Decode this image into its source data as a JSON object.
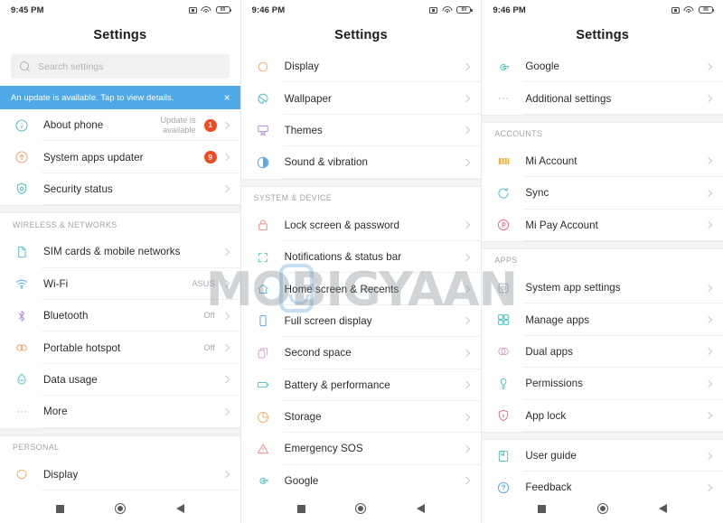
{
  "watermark": {
    "text": "MOBIGYAAN"
  },
  "navbar": {
    "recents_label": "recents",
    "home_label": "home",
    "back_label": "back"
  },
  "panels": [
    {
      "status": {
        "time": "9:45 PM",
        "battery_level": "89"
      },
      "title": "Settings",
      "search": {
        "placeholder": "Search settings"
      },
      "banner": {
        "text": "An update is available. Tap to view details.",
        "close": "×",
        "color": "#4fa8e8"
      },
      "rows": [
        {
          "type": "item",
          "icon": "info-circle-icon",
          "color": "#4dbfc4",
          "label": "About phone",
          "value": "Update is\navailable",
          "badge": "1"
        },
        {
          "type": "item",
          "icon": "system-update-icon",
          "color": "#f0a070",
          "label": "System apps updater",
          "value": "",
          "badge": "9"
        },
        {
          "type": "item",
          "icon": "shield-icon",
          "color": "#4dbfc4",
          "label": "Security status",
          "value": "",
          "badge": ""
        },
        {
          "type": "group",
          "label": "WIRELESS & NETWORKS"
        },
        {
          "type": "item",
          "icon": "sim-card-icon",
          "color": "#55c3c8",
          "label": "SIM cards & mobile networks",
          "value": "",
          "badge": ""
        },
        {
          "type": "item",
          "icon": "wifi-icon",
          "color": "#5aa8e8",
          "label": "Wi-Fi",
          "value": "ASUS",
          "badge": ""
        },
        {
          "type": "item",
          "icon": "bluetooth-icon",
          "color": "#b48ce0",
          "label": "Bluetooth",
          "value": "Off",
          "badge": ""
        },
        {
          "type": "item",
          "icon": "hotspot-icon",
          "color": "#f0a070",
          "label": "Portable hotspot",
          "value": "Off",
          "badge": ""
        },
        {
          "type": "item",
          "icon": "data-usage-icon",
          "color": "#55c3c8",
          "label": "Data usage",
          "value": "",
          "badge": ""
        },
        {
          "type": "item",
          "icon": "more-dots-icon",
          "color": "#9fb4d6",
          "label": "More",
          "value": "",
          "badge": ""
        },
        {
          "type": "group",
          "label": "PERSONAL"
        },
        {
          "type": "item",
          "icon": "display-icon",
          "color": "#efb36d",
          "label": "Display",
          "value": "",
          "badge": ""
        }
      ]
    },
    {
      "status": {
        "time": "9:46 PM",
        "battery_level": "89"
      },
      "title": "Settings",
      "rows": [
        {
          "type": "item",
          "icon": "display-icon",
          "color": "#efb36d",
          "label": "Display",
          "value": "",
          "badge": ""
        },
        {
          "type": "item",
          "icon": "wallpaper-icon",
          "color": "#55c3c8",
          "label": "Wallpaper",
          "value": "",
          "badge": ""
        },
        {
          "type": "item",
          "icon": "themes-icon",
          "color": "#b48ce0",
          "label": "Themes",
          "value": "",
          "badge": ""
        },
        {
          "type": "item",
          "icon": "sound-vibration-icon",
          "color": "#5aa8e8",
          "label": "Sound & vibration",
          "value": "",
          "badge": ""
        },
        {
          "type": "group",
          "label": "SYSTEM & DEVICE"
        },
        {
          "type": "item",
          "icon": "lock-icon",
          "color": "#ef8b8b",
          "label": "Lock screen & password",
          "value": "",
          "badge": ""
        },
        {
          "type": "item",
          "icon": "notifications-status-bar-icon",
          "color": "#55c3c8",
          "label": "Notifications & status bar",
          "value": "",
          "badge": ""
        },
        {
          "type": "item",
          "icon": "home-screen-icon",
          "color": "#55b9e0",
          "label": "Home screen & Recents",
          "value": "",
          "badge": ""
        },
        {
          "type": "item",
          "icon": "full-screen-display-icon",
          "color": "#5aa8e8",
          "label": "Full screen display",
          "value": "",
          "badge": ""
        },
        {
          "type": "item",
          "icon": "second-space-icon",
          "color": "#d79fd0",
          "label": "Second space",
          "value": "",
          "badge": ""
        },
        {
          "type": "item",
          "icon": "battery-performance-icon",
          "color": "#55c3c8",
          "label": "Battery & performance",
          "value": "",
          "badge": ""
        },
        {
          "type": "item",
          "icon": "storage-icon",
          "color": "#efb36d",
          "label": "Storage",
          "value": "",
          "badge": ""
        },
        {
          "type": "item",
          "icon": "emergency-sos-icon",
          "color": "#ef8b8b",
          "label": "Emergency SOS",
          "value": "",
          "badge": ""
        },
        {
          "type": "item",
          "icon": "google-icon",
          "color": "#4dbfc4",
          "label": "Google",
          "value": "",
          "badge": ""
        }
      ]
    },
    {
      "status": {
        "time": "9:46 PM",
        "battery_level": "89"
      },
      "title": "Settings",
      "rows": [
        {
          "type": "item",
          "icon": "google-icon",
          "color": "#4dbfc4",
          "label": "Google",
          "value": "",
          "badge": ""
        },
        {
          "type": "item",
          "icon": "additional-settings-icon",
          "color": "#9fb4d6",
          "label": "Additional settings",
          "value": "",
          "badge": ""
        },
        {
          "type": "group",
          "label": "ACCOUNTS"
        },
        {
          "type": "item",
          "icon": "mi-account-icon",
          "color": "#efb03d",
          "label": "Mi Account",
          "value": "",
          "badge": ""
        },
        {
          "type": "item",
          "icon": "sync-icon",
          "color": "#4dbfc4",
          "label": "Sync",
          "value": "",
          "badge": ""
        },
        {
          "type": "item",
          "icon": "mi-pay-icon",
          "color": "#e8708f",
          "label": "Mi Pay Account",
          "value": "",
          "badge": ""
        },
        {
          "type": "group",
          "label": "APPS"
        },
        {
          "type": "item",
          "icon": "system-app-settings-icon",
          "color": "#a9b0bb",
          "label": "System app settings",
          "value": "",
          "badge": ""
        },
        {
          "type": "item",
          "icon": "manage-apps-icon",
          "color": "#44c2b8",
          "label": "Manage apps",
          "value": "",
          "badge": ""
        },
        {
          "type": "item",
          "icon": "dual-apps-icon",
          "color": "#d79fd0",
          "label": "Dual apps",
          "value": "",
          "badge": ""
        },
        {
          "type": "item",
          "icon": "permissions-icon",
          "color": "#55c3c8",
          "label": "Permissions",
          "value": "",
          "badge": ""
        },
        {
          "type": "item",
          "icon": "app-lock-icon",
          "color": "#e8708f",
          "label": "App lock",
          "value": "",
          "badge": ""
        },
        {
          "type": "group",
          "label": ""
        },
        {
          "type": "item",
          "icon": "user-guide-icon",
          "color": "#55c3c8",
          "label": "User guide",
          "value": "",
          "badge": ""
        },
        {
          "type": "item",
          "icon": "feedback-icon",
          "color": "#5aa8e8",
          "label": "Feedback",
          "value": "",
          "badge": ""
        }
      ]
    }
  ]
}
